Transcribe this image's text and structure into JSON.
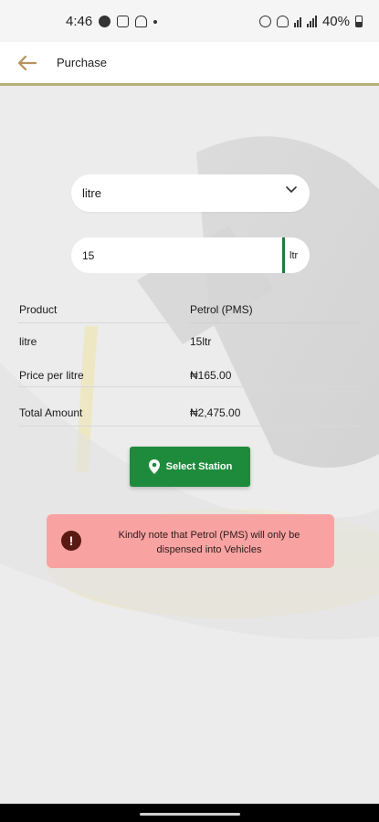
{
  "status_bar": {
    "time": "4:46",
    "battery": "40%"
  },
  "header": {
    "title": "Purchase",
    "accent_color": "#b5b17a"
  },
  "form": {
    "unit_dropdown": {
      "selected": "litre"
    },
    "quantity": {
      "value": "15",
      "unit": "ltr"
    }
  },
  "summary": {
    "rows": [
      {
        "label": "Product",
        "value": "Petrol (PMS)"
      },
      {
        "label": "litre",
        "value": "15ltr"
      },
      {
        "label": "Price per litre",
        "value": "₦165.00"
      },
      {
        "label": "Total Amount",
        "value": "₦2,475.00"
      }
    ]
  },
  "actions": {
    "select_station_label": "Select Station",
    "button_color": "#1e8b3c"
  },
  "notice": {
    "text": "Kindly note that Petrol (PMS) will only be dispensed into Vehicles",
    "color": "#f8a3a2"
  }
}
